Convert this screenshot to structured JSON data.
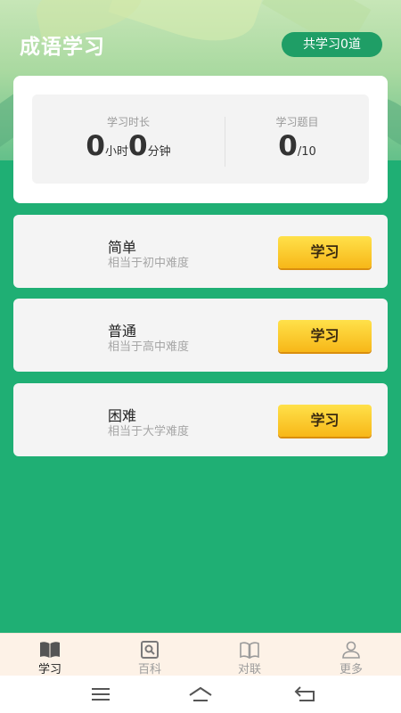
{
  "header": {
    "title": "成语学习",
    "total_badge": "共学习0道"
  },
  "stats": {
    "time": {
      "label": "学习时长",
      "hours": "0",
      "hours_unit": "小时",
      "minutes": "0",
      "minutes_unit": "分钟"
    },
    "questions": {
      "label": "学习题目",
      "done": "0",
      "total": "/10"
    }
  },
  "levels": [
    {
      "name": "简单",
      "desc": "相当于初中难度",
      "button": "学习"
    },
    {
      "name": "普通",
      "desc": "相当于高中难度",
      "button": "学习"
    },
    {
      "name": "困难",
      "desc": "相当于大学难度",
      "button": "学习"
    }
  ],
  "tabs": [
    {
      "label": "学习",
      "icon": "open-book-icon",
      "active": true
    },
    {
      "label": "百科",
      "icon": "encyclopedia-icon",
      "active": false
    },
    {
      "label": "对联",
      "icon": "couplet-icon",
      "active": false
    },
    {
      "label": "更多",
      "icon": "person-icon",
      "active": false
    }
  ],
  "system_nav": {
    "icons": [
      "menu-icon",
      "home-icon",
      "back-icon"
    ]
  },
  "colors": {
    "background": "#1faf74",
    "badge": "#1f9e66",
    "button": "#f7b718",
    "tabbar": "#fdf2e7"
  }
}
